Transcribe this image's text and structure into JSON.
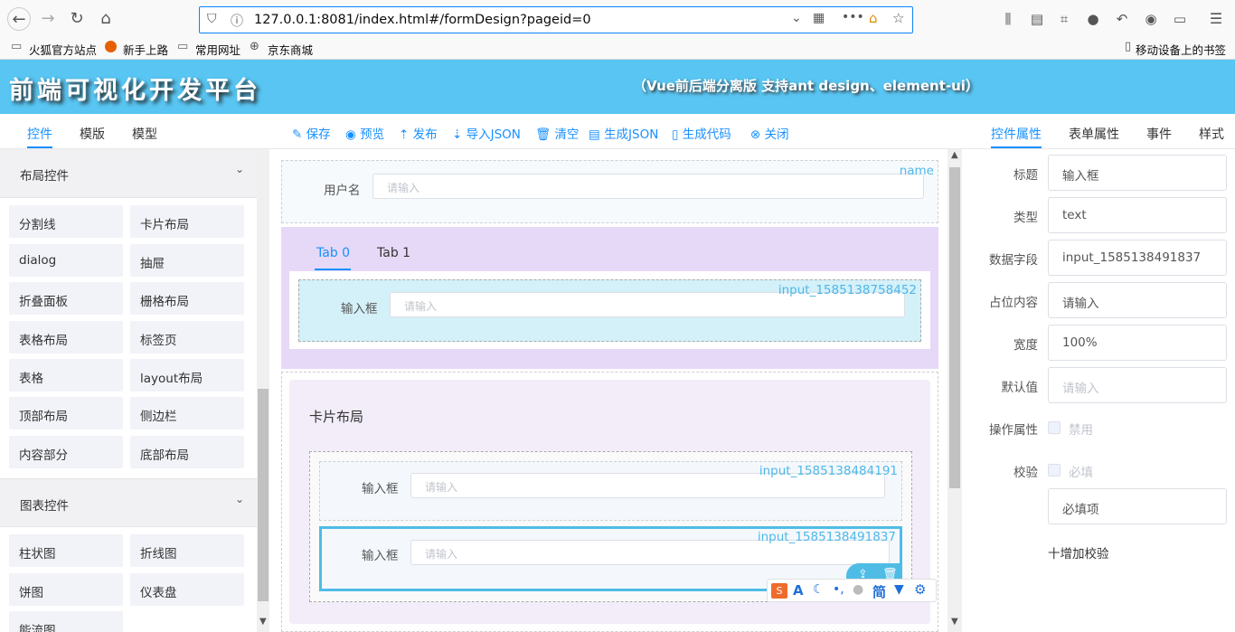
{
  "browser": {
    "url": "127.0.0.1:8081/index.html#/formDesign?pageid=0",
    "bookmarks": [
      "火狐官方站点",
      "新手上路",
      "常用网址",
      "京东商城"
    ],
    "mobile_bookmarks": "移动设备上的书签"
  },
  "header": {
    "title": "前端可视化开发平台",
    "subtitle": "（Vue前后端分离版 支持ant design、element-ui）"
  },
  "left_tabs": [
    "控件",
    "模版",
    "模型"
  ],
  "toolbar": [
    {
      "icon": "edit-icon",
      "label": "保存"
    },
    {
      "icon": "eye-icon",
      "label": "预览"
    },
    {
      "icon": "upload-icon",
      "label": "发布"
    },
    {
      "icon": "download-icon",
      "label": "导入JSON"
    },
    {
      "icon": "trash-icon",
      "label": "清空"
    },
    {
      "icon": "document-icon",
      "label": "生成JSON"
    },
    {
      "icon": "file-icon",
      "label": "生成代码"
    },
    {
      "icon": "close-circle-icon",
      "label": "关闭"
    }
  ],
  "right_tabs": [
    "控件属性",
    "表单属性",
    "事件",
    "样式"
  ],
  "left_panel": {
    "group1": "布局控件",
    "items1": [
      "分割线",
      "卡片布局",
      "dialog",
      "抽屉",
      "折叠面板",
      "栅格布局",
      "表格布局",
      "标签页",
      "表格",
      "layout布局",
      "顶部布局",
      "侧边栏",
      "内容部分",
      "底部布局"
    ],
    "group2": "图表控件",
    "items2": [
      "柱状图",
      "折线图",
      "饼图",
      "仪表盘",
      "能流图"
    ]
  },
  "canvas": {
    "username_label": "用户名",
    "username_placeholder": "请输入",
    "username_field": "name",
    "tabs": [
      "Tab 0",
      "Tab 1"
    ],
    "tab_input_label": "输入框",
    "tab_input_placeholder": "请输入",
    "tab_input_field": "input_1585138758452",
    "card_title": "卡片布局",
    "card_input1_label": "输入框",
    "card_input1_placeholder": "请输入",
    "card_input1_field": "input_1585138484191",
    "card_input2_label": "输入框",
    "card_input2_placeholder": "请输入",
    "card_input2_field": "input_1585138491837",
    "ime_simplified": "简"
  },
  "properties": {
    "title_label": "标题",
    "title_value": "输入框",
    "type_label": "类型",
    "type_value": "text",
    "field_label": "数据字段",
    "field_value": "input_1585138491837",
    "placeholder_label": "占位内容",
    "placeholder_value": "请输入",
    "width_label": "宽度",
    "width_value": "100%",
    "default_label": "默认值",
    "default_placeholder": "请输入",
    "ops_label": "操作属性",
    "disabled_text": "禁用",
    "validate_label": "校验",
    "required_text": "必填",
    "required_msg": "必填项",
    "add_validation": "十增加校验"
  },
  "colors": {
    "header": "#58c5f2",
    "accent": "#1890ff",
    "tab_bg": "#e6d9f7",
    "selected_border": "#4fbce6"
  }
}
